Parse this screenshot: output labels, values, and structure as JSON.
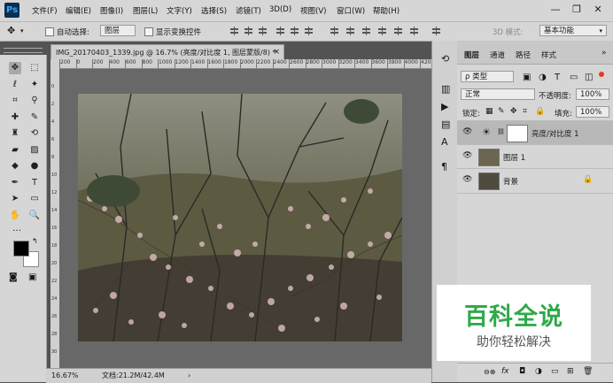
{
  "app": {
    "logo": "Ps"
  },
  "menubar": {
    "items": [
      "文件(F)",
      "编辑(E)",
      "图像(I)",
      "图层(L)",
      "文字(Y)",
      "选择(S)",
      "滤镜(T)",
      "3D(D)",
      "视图(V)",
      "窗口(W)",
      "帮助(H)"
    ],
    "window_controls": [
      "minimize-icon",
      "restore-icon",
      "close-icon"
    ],
    "window_glyphs": [
      "—",
      "❐",
      "✕"
    ]
  },
  "options_bar": {
    "auto_select_label": "自动选择:",
    "auto_select_value": "图层",
    "show_transform_label": "显示变换控件",
    "mode_3d_label": "3D 模式:",
    "workspace_value": "基本功能"
  },
  "tools": [
    {
      "icon": "move-icon",
      "glyph": "✥"
    },
    {
      "icon": "marquee-icon",
      "glyph": "⬚"
    },
    {
      "icon": "lasso-icon",
      "glyph": "ℓ"
    },
    {
      "icon": "magic-wand-icon",
      "glyph": "✦"
    },
    {
      "icon": "crop-icon",
      "glyph": "⌗"
    },
    {
      "icon": "eyedropper-icon",
      "glyph": "⚲"
    },
    {
      "icon": "healing-brush-icon",
      "glyph": "✚"
    },
    {
      "icon": "brush-icon",
      "glyph": "✎"
    },
    {
      "icon": "clone-stamp-icon",
      "glyph": "♜"
    },
    {
      "icon": "history-brush-icon",
      "glyph": "⟲"
    },
    {
      "icon": "eraser-icon",
      "glyph": "▰"
    },
    {
      "icon": "gradient-icon",
      "glyph": "▨"
    },
    {
      "icon": "blur-icon",
      "glyph": "◆"
    },
    {
      "icon": "dodge-icon",
      "glyph": "●"
    },
    {
      "icon": "pen-icon",
      "glyph": "✒"
    },
    {
      "icon": "type-icon",
      "glyph": "T"
    },
    {
      "icon": "path-selection-icon",
      "glyph": "➤"
    },
    {
      "icon": "shape-icon",
      "glyph": "▭"
    },
    {
      "icon": "hand-icon",
      "glyph": "✋"
    },
    {
      "icon": "zoom-icon",
      "glyph": "🔍"
    },
    {
      "icon": "more-tools-icon",
      "glyph": "…"
    }
  ],
  "colors": {
    "foreground": "#000000",
    "background": "#ffffff",
    "accent": "#e63a1f"
  },
  "document": {
    "tab_title": "IMG_20170403_1339.jpg @ 16.7% (亮度/对比度 1, 图层蒙版/8) *",
    "close": "×",
    "ruler_ticks": [
      "200",
      "0",
      "200",
      "400",
      "600",
      "800",
      "1000",
      "1200",
      "1400",
      "1600",
      "1800",
      "2000",
      "2200",
      "2400",
      "2600",
      "2800",
      "3000",
      "3200",
      "3400",
      "3600",
      "3800",
      "4000",
      "4200"
    ],
    "vertical_ruler_ticks": [
      "0",
      "2",
      "4",
      "6",
      "8",
      "10",
      "12",
      "14",
      "16",
      "18",
      "20",
      "22",
      "24",
      "26",
      "28",
      "30"
    ]
  },
  "status": {
    "zoom": "16.67%",
    "doc_info": "文档:21.2M/42.4M",
    "arrow": "›"
  },
  "right_minibar": {
    "icons": [
      "history-icon",
      "properties-icon",
      "play-icon",
      "paragraph-icon",
      "char-icon",
      "glyph-panel-icon",
      "paragraph-mark-icon"
    ]
  },
  "layers_panel": {
    "tabs": [
      "图层",
      "通道",
      "路径",
      "样式"
    ],
    "collapse": "»",
    "filter_label": "ρ 类型",
    "blend_mode": "正常",
    "opacity_label": "不透明度:",
    "opacity_value": "100%",
    "lock_label": "锁定:",
    "fill_label": "填充:",
    "fill_value": "100%",
    "layers": [
      {
        "name": "亮度/对比度 1",
        "type": "adjustment",
        "selected": true
      },
      {
        "name": "图层 1",
        "type": "pixel",
        "selected": false
      },
      {
        "name": "背景",
        "type": "background",
        "selected": false
      }
    ],
    "footer_icons": [
      "link-icon",
      "fx-icon",
      "mask-icon",
      "adjustment-icon",
      "folder-icon",
      "new-layer-icon",
      "trash-icon"
    ],
    "footer_labels": [
      "⊖⊕",
      "fx",
      "◘",
      "◑",
      "▭",
      "⊞",
      "🗑"
    ]
  },
  "watermark": {
    "title": "百科全说",
    "subtitle": "助你轻松解决"
  }
}
